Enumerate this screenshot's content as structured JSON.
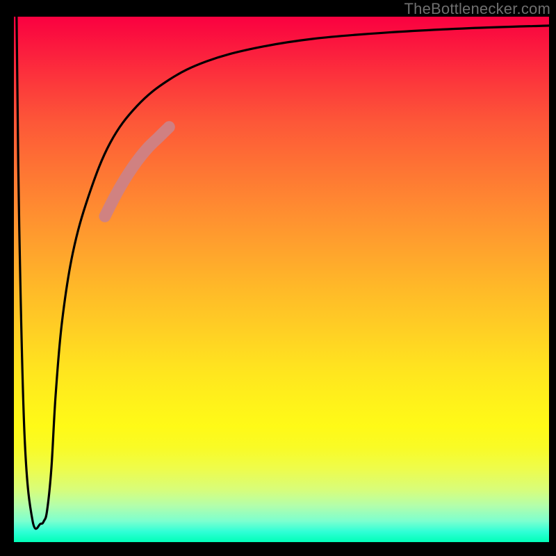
{
  "attribution": "TheBottlenecker.com",
  "colors": {
    "frame": "#000000",
    "curve": "#000000",
    "highlight": "#ce8286",
    "attribution_text": "#6f6f6f",
    "gradient_top": "#fa0040",
    "gradient_bottom": "#00ffb8"
  },
  "chart_data": {
    "type": "line",
    "title": "",
    "xlabel": "",
    "ylabel": "",
    "xlim": [
      0,
      100
    ],
    "ylim": [
      0,
      100
    ],
    "grid": false,
    "legend": false,
    "series": [
      {
        "name": "bottleneck-curve",
        "x": [
          0.5,
          1,
          2,
          3.5,
          5,
          5.6,
          6.2,
          7,
          7.8,
          9,
          11,
          14,
          18,
          23,
          29,
          36,
          45,
          56,
          70,
          85,
          100
        ],
        "y": [
          100,
          60,
          20,
          4,
          3.5,
          4,
          6,
          14,
          28,
          42,
          55,
          66,
          76,
          83,
          88,
          91.5,
          94,
          95.8,
          97,
          97.8,
          98.3
        ]
      },
      {
        "name": "highlight-segment",
        "x": [
          17,
          19,
          21,
          23,
          25,
          27,
          29
        ],
        "y": [
          62,
          66,
          69.5,
          72.5,
          75,
          77,
          79
        ]
      }
    ],
    "background_gradient": {
      "orientation": "vertical",
      "meaning": "bottleneck-severity-heatmap",
      "stops": [
        {
          "pos": 0.0,
          "color": "#fa0040"
        },
        {
          "pos": 0.5,
          "color": "#ffba28"
        },
        {
          "pos": 0.78,
          "color": "#fffa17"
        },
        {
          "pos": 1.0,
          "color": "#00ffb8"
        }
      ]
    }
  }
}
